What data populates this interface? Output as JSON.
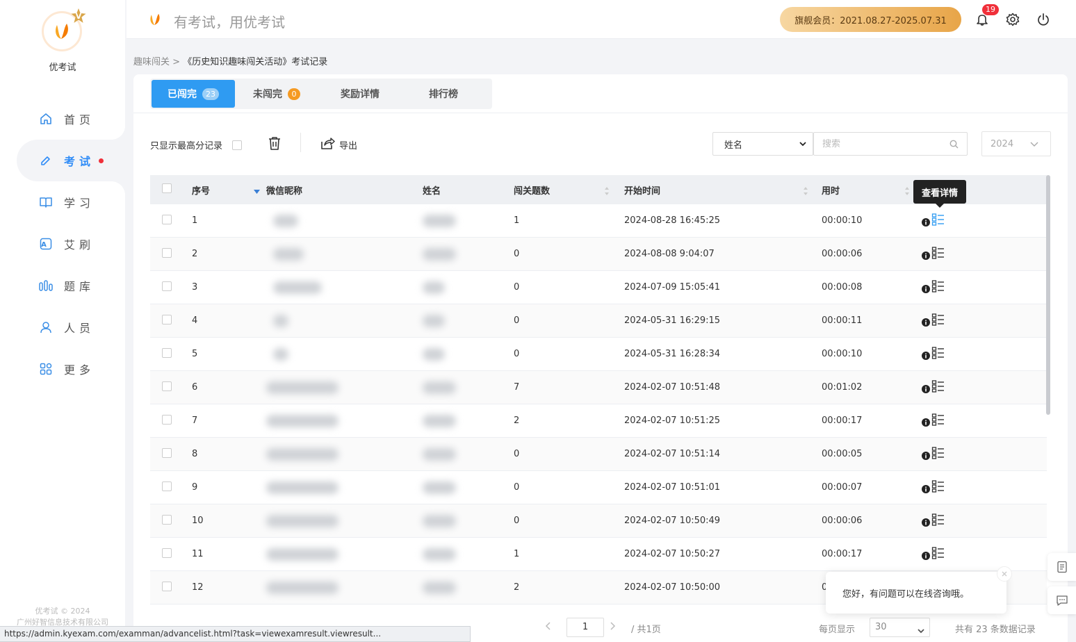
{
  "sidebar": {
    "logo_text": "优考试",
    "logo_badge": "V",
    "items": [
      {
        "label": "首页",
        "icon": "home-icon"
      },
      {
        "label": "考试",
        "icon": "exam-icon",
        "active": true
      },
      {
        "label": "学习",
        "icon": "book-icon"
      },
      {
        "label": "艾刷",
        "icon": "brush-icon"
      },
      {
        "label": "题库",
        "icon": "question-bank-icon"
      },
      {
        "label": "人员",
        "icon": "user-icon"
      },
      {
        "label": "更多",
        "icon": "more-icon"
      }
    ],
    "copyright_line1": "优考试 © 2024",
    "copyright_line2": "广州好智信息技术有限公司"
  },
  "header": {
    "title": "有考试，用优考试",
    "vip": "旗舰会员：2021.08.27-2025.07.31",
    "notification_count": "19"
  },
  "breadcrumb": {
    "parent": "趣味闯关",
    "separator": " > ",
    "current": "《历史知识趣味闯关活动》考试记录"
  },
  "tabs": [
    {
      "label": "已闯完",
      "badge": "23",
      "active": true
    },
    {
      "label": "未闯完",
      "badge": "0"
    },
    {
      "label": "奖励详情"
    },
    {
      "label": "排行榜"
    }
  ],
  "toolbar": {
    "only_highest_label": "只显示最高分记录",
    "export_label": "导出",
    "search_field_value": "姓名",
    "search_placeholder": "搜索",
    "year_value": "2024"
  },
  "table": {
    "headers": {
      "no": "序号",
      "nickname": "微信昵称",
      "name": "姓名",
      "count": "闯关题数",
      "start": "开始时间",
      "time": "用时"
    },
    "rows": [
      {
        "no": "1",
        "count": "1",
        "start": "2024-08-28 16:45:25",
        "time": "00:00:10"
      },
      {
        "no": "2",
        "count": "0",
        "start": "2024-08-08 9:04:07",
        "time": "00:00:06"
      },
      {
        "no": "3",
        "count": "0",
        "start": "2024-07-09 15:05:41",
        "time": "00:00:08"
      },
      {
        "no": "4",
        "count": "0",
        "start": "2024-05-31 16:29:15",
        "time": "00:00:11"
      },
      {
        "no": "5",
        "count": "0",
        "start": "2024-05-31 16:28:34",
        "time": "00:00:10"
      },
      {
        "no": "6",
        "count": "7",
        "start": "2024-02-07 10:51:48",
        "time": "00:01:02"
      },
      {
        "no": "7",
        "count": "2",
        "start": "2024-02-07 10:51:25",
        "time": "00:00:17"
      },
      {
        "no": "8",
        "count": "0",
        "start": "2024-02-07 10:51:14",
        "time": "00:00:05"
      },
      {
        "no": "9",
        "count": "0",
        "start": "2024-02-07 10:51:01",
        "time": "00:00:07"
      },
      {
        "no": "10",
        "count": "0",
        "start": "2024-02-07 10:50:49",
        "time": "00:00:06"
      },
      {
        "no": "11",
        "count": "1",
        "start": "2024-02-07 10:50:27",
        "time": "00:00:17"
      },
      {
        "no": "12",
        "count": "2",
        "start": "2024-02-07 10:50:00",
        "time": "0"
      }
    ]
  },
  "tooltip": "查看详情",
  "pagination": {
    "page": "1",
    "total_pages": "/ 共1页",
    "per_page_label": "每页显示",
    "per_page_value": "30",
    "total_records": "共有 23 条数据记录"
  },
  "chat": {
    "message": "您好，有问题可以在线咨询哦。"
  },
  "statusbar": "https://admin.kyexam.com/examman/advancelist.html?task=viewexamresult.viewresult...",
  "colors": {
    "primary": "#2f9bf2",
    "active_nav": "#2f8cf7",
    "badge_red": "#f0303a",
    "badge_orange": "#f59a23"
  }
}
